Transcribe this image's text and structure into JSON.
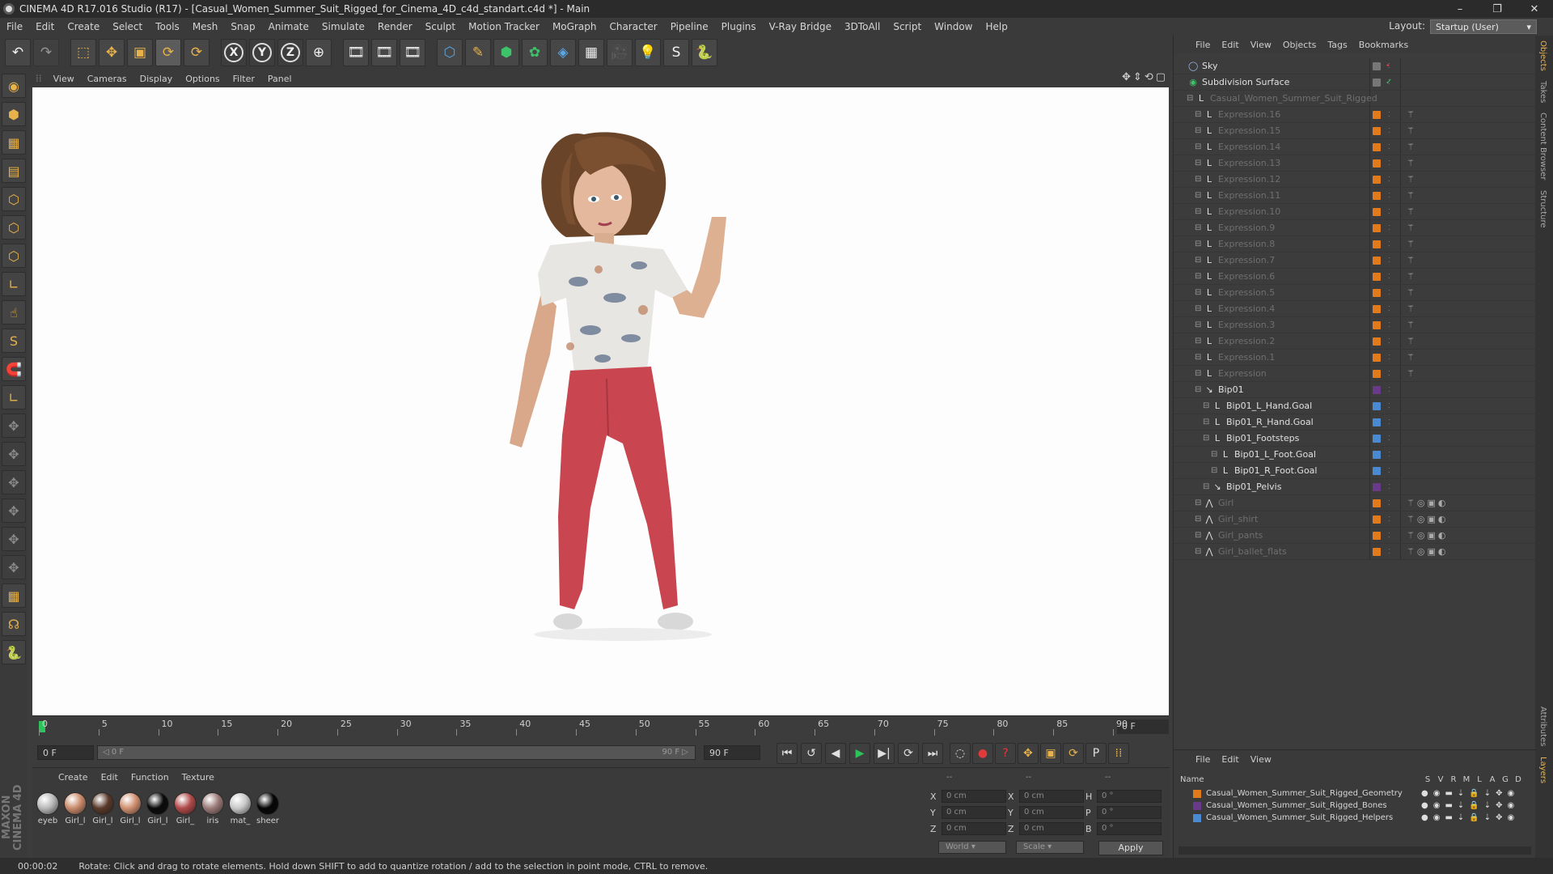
{
  "window": {
    "title": "CINEMA 4D R17.016 Studio (R17) - [Casual_Women_Summer_Suit_Rigged_for_Cinema_4D_c4d_standart.c4d *] - Main",
    "controls": [
      "–",
      "❐",
      "✕"
    ]
  },
  "menu": [
    "File",
    "Edit",
    "Create",
    "Select",
    "Tools",
    "Mesh",
    "Snap",
    "Animate",
    "Simulate",
    "Render",
    "Sculpt",
    "Motion Tracker",
    "MoGraph",
    "Character",
    "Pipeline",
    "Plugins",
    "V-Ray Bridge",
    "3DToAll",
    "Script",
    "Window",
    "Help"
  ],
  "layout": {
    "label": "Layout:",
    "value": "Startup (User)"
  },
  "toolbar": {
    "undo": "↶",
    "redo": "↷",
    "tools": [
      "⬚",
      "✥",
      "▣",
      "⟳",
      "⟳"
    ],
    "axes": [
      "X",
      "Y",
      "Z"
    ],
    "world": "⊕",
    "render": [
      "🎞",
      "🎞",
      "🎞"
    ],
    "objects": [
      "⬡",
      "✎",
      "⬢",
      "✿",
      "◈",
      "▦",
      "🎥",
      "💡",
      "S",
      "🐍"
    ]
  },
  "left_palette": [
    "◉",
    "⬢",
    "▦",
    "▤",
    "⬡",
    "⬡",
    "⬡",
    "∟",
    "☝",
    "S",
    "🧲",
    "∟",
    "✥",
    "✥",
    "✥",
    "✥",
    "✥",
    "✥",
    "▦",
    "☊",
    "🐍"
  ],
  "maxon_logo": "MAXON CINEMA 4D",
  "viewport": {
    "menu": [
      "View",
      "Cameras",
      "Display",
      "Options",
      "Filter",
      "Panel"
    ],
    "nav_icons": "✥⇕⟲▢"
  },
  "timeline": {
    "ticks": [
      "0",
      "5",
      "10",
      "15",
      "20",
      "25",
      "30",
      "35",
      "40",
      "45",
      "50",
      "55",
      "60",
      "65",
      "70",
      "75",
      "80",
      "85",
      "90"
    ],
    "current_frame": "0 F",
    "start_field": "0 F",
    "range_start": "◁ 0 F",
    "range_end": "90 F ▷",
    "end_field": "90 F"
  },
  "transport": [
    "⏮",
    "↺",
    "◀",
    "▶",
    "▶|",
    "⟳",
    "⏭"
  ],
  "transport_right": [
    "◌",
    "●",
    "?",
    "✥",
    "▣",
    "⟳",
    "P",
    "⁞⁞"
  ],
  "materials": {
    "menu": [
      "Create",
      "Edit",
      "Function",
      "Texture"
    ],
    "items": [
      {
        "label": "eyeb",
        "color": "#b8b8b8"
      },
      {
        "label": "Girl_l",
        "color": "#c98a6a"
      },
      {
        "label": "Girl_l",
        "color": "#5a3a2a"
      },
      {
        "label": "Girl_l",
        "color": "#d09070"
      },
      {
        "label": "Girl_l",
        "color": "#0a0a0a"
      },
      {
        "label": "Girl_",
        "color": "#b04a4a"
      },
      {
        "label": "iris",
        "color": "#9a7a78"
      },
      {
        "label": "mat_",
        "color": "#c8c8c8"
      },
      {
        "label": "sheer",
        "color": "#050505"
      }
    ]
  },
  "coords": {
    "header": [
      "--",
      "--",
      "--"
    ],
    "rows": [
      {
        "a": "X",
        "av": "0 cm",
        "b": "X",
        "bv": "0 cm",
        "c": "H",
        "cv": "0 °"
      },
      {
        "a": "Y",
        "av": "0 cm",
        "b": "Y",
        "bv": "0 cm",
        "c": "P",
        "cv": "0 °"
      },
      {
        "a": "Z",
        "av": "0 cm",
        "b": "Z",
        "bv": "0 cm",
        "c": "B",
        "cv": "0 °"
      }
    ],
    "world": "World",
    "scale": "Scale",
    "apply": "Apply"
  },
  "status": {
    "time": "00:00:02",
    "message": "Rotate: Click and drag to rotate elements. Hold down SHIFT to add to quantize rotation / add to the selection in point mode, CTRL to remove."
  },
  "objects": {
    "menu": [
      "File",
      "Edit",
      "View",
      "Objects",
      "Tags",
      "Bookmarks"
    ],
    "rows": [
      {
        "name": "Sky",
        "indent": 0,
        "dim": false,
        "icon": "◯",
        "tag": "#777777"
      },
      {
        "name": "Subdivision Surface",
        "indent": 0,
        "dim": false,
        "icon": "◉",
        "tag": "#777777"
      },
      {
        "name": "Casual_Women_Summer_Suit_Rigged",
        "indent": 1,
        "dim": true,
        "icon": "L",
        "tag": ""
      },
      {
        "name": "Expression.16",
        "indent": 2,
        "dim": true,
        "icon": "L",
        "tag": "#e07a1a"
      },
      {
        "name": "Expression.15",
        "indent": 2,
        "dim": true,
        "icon": "L",
        "tag": "#e07a1a"
      },
      {
        "name": "Expression.14",
        "indent": 2,
        "dim": true,
        "icon": "L",
        "tag": "#e07a1a"
      },
      {
        "name": "Expression.13",
        "indent": 2,
        "dim": true,
        "icon": "L",
        "tag": "#e07a1a"
      },
      {
        "name": "Expression.12",
        "indent": 2,
        "dim": true,
        "icon": "L",
        "tag": "#e07a1a"
      },
      {
        "name": "Expression.11",
        "indent": 2,
        "dim": true,
        "icon": "L",
        "tag": "#e07a1a"
      },
      {
        "name": "Expression.10",
        "indent": 2,
        "dim": true,
        "icon": "L",
        "tag": "#e07a1a"
      },
      {
        "name": "Expression.9",
        "indent": 2,
        "dim": true,
        "icon": "L",
        "tag": "#e07a1a"
      },
      {
        "name": "Expression.8",
        "indent": 2,
        "dim": true,
        "icon": "L",
        "tag": "#e07a1a"
      },
      {
        "name": "Expression.7",
        "indent": 2,
        "dim": true,
        "icon": "L",
        "tag": "#e07a1a"
      },
      {
        "name": "Expression.6",
        "indent": 2,
        "dim": true,
        "icon": "L",
        "tag": "#e07a1a"
      },
      {
        "name": "Expression.5",
        "indent": 2,
        "dim": true,
        "icon": "L",
        "tag": "#e07a1a"
      },
      {
        "name": "Expression.4",
        "indent": 2,
        "dim": true,
        "icon": "L",
        "tag": "#e07a1a"
      },
      {
        "name": "Expression.3",
        "indent": 2,
        "dim": true,
        "icon": "L",
        "tag": "#e07a1a"
      },
      {
        "name": "Expression.2",
        "indent": 2,
        "dim": true,
        "icon": "L",
        "tag": "#e07a1a"
      },
      {
        "name": "Expression.1",
        "indent": 2,
        "dim": true,
        "icon": "L",
        "tag": "#e07a1a"
      },
      {
        "name": "Expression",
        "indent": 2,
        "dim": true,
        "icon": "L",
        "tag": "#e07a1a"
      },
      {
        "name": "Bip01",
        "indent": 2,
        "dim": false,
        "icon": "↘",
        "tag": "#6a3a8a"
      },
      {
        "name": "Bip01_L_Hand.Goal",
        "indent": 3,
        "dim": false,
        "icon": "L",
        "tag": "#4a8ad0"
      },
      {
        "name": "Bip01_R_Hand.Goal",
        "indent": 3,
        "dim": false,
        "icon": "L",
        "tag": "#4a8ad0"
      },
      {
        "name": "Bip01_Footsteps",
        "indent": 3,
        "dim": false,
        "icon": "L",
        "tag": "#4a8ad0"
      },
      {
        "name": "Bip01_L_Foot.Goal",
        "indent": 4,
        "dim": false,
        "icon": "L",
        "tag": "#4a8ad0"
      },
      {
        "name": "Bip01_R_Foot.Goal",
        "indent": 4,
        "dim": false,
        "icon": "L",
        "tag": "#4a8ad0"
      },
      {
        "name": "Bip01_Pelvis",
        "indent": 3,
        "dim": false,
        "icon": "↘",
        "tag": "#6a3a8a"
      },
      {
        "name": "Girl",
        "indent": 2,
        "dim": true,
        "icon": "⋀",
        "tag": "#e07a1a"
      },
      {
        "name": "Girl_shirt",
        "indent": 2,
        "dim": true,
        "icon": "⋀",
        "tag": "#e07a1a"
      },
      {
        "name": "Girl_pants",
        "indent": 2,
        "dim": true,
        "icon": "⋀",
        "tag": "#e07a1a"
      },
      {
        "name": "Girl_ballet_flats",
        "indent": 2,
        "dim": true,
        "icon": "⋀",
        "tag": "#e07a1a"
      }
    ]
  },
  "vertical_tabs": [
    "Objects",
    "Takes",
    "Content Browser",
    "Structure",
    "Attributes",
    "Layers"
  ],
  "layers": {
    "menu": [
      "File",
      "Edit",
      "View"
    ],
    "header": {
      "name": "Name",
      "flags": [
        "S",
        "V",
        "R",
        "M",
        "L",
        "A",
        "G",
        "D"
      ]
    },
    "rows": [
      {
        "name": "Casual_Women_Summer_Suit_Rigged_Geometry",
        "color": "#e07a1a"
      },
      {
        "name": "Casual_Women_Summer_Suit_Rigged_Bones",
        "color": "#6a3a8a"
      },
      {
        "name": "Casual_Women_Summer_Suit_Rigged_Helpers",
        "color": "#4a8ad0"
      }
    ]
  }
}
